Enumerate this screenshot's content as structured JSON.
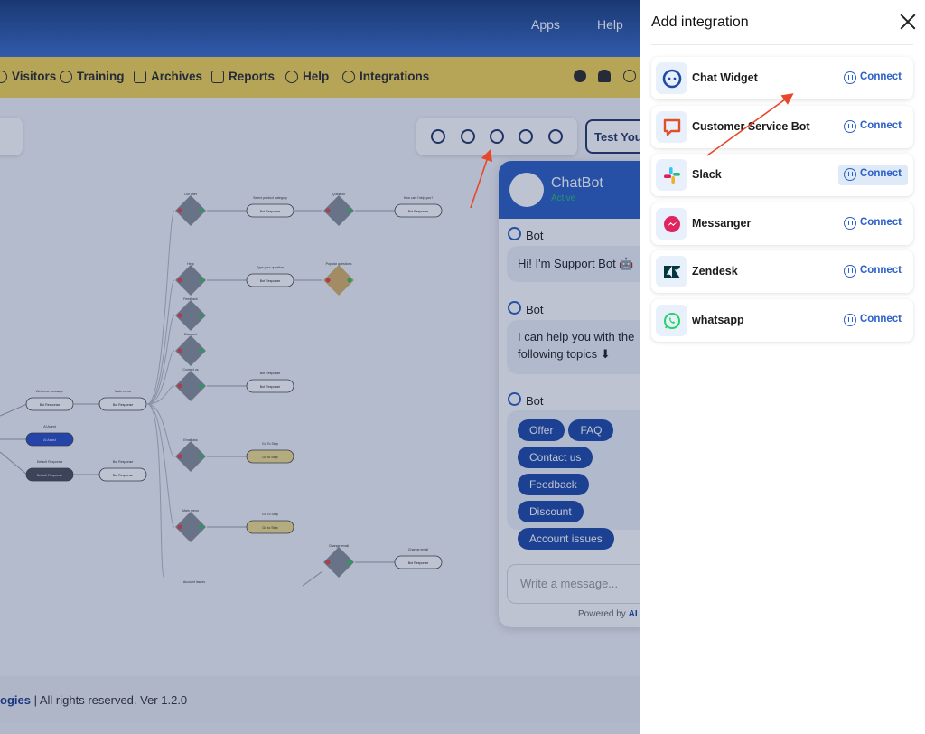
{
  "topbar": {
    "apps_label": "Apps",
    "help_label": "Help"
  },
  "nav": {
    "items": [
      {
        "label": "Visitors"
      },
      {
        "label": "Training"
      },
      {
        "label": "Archives"
      },
      {
        "label": "Reports"
      },
      {
        "label": "Help"
      },
      {
        "label": "Integrations"
      }
    ]
  },
  "toolbar": {
    "test_label": "Test Your"
  },
  "flow": {
    "node_labels": [
      "Our offer",
      "Select product category",
      "Question",
      "How can I help you?",
      "Help",
      "Type your question",
      "Popular questions",
      "Feedback",
      "Discount",
      "Contact us",
      "Bot Response",
      "Welcome message",
      "Main menu",
      "AI Agent",
      "Default Response",
      "Bot Response",
      "Email ask",
      "Go To Step",
      "Main menu",
      "Go To Step",
      "Change email",
      "Change email",
      "Account issues"
    ],
    "pill_labels": [
      "Bot Response",
      "Bot Response",
      "Bot Response",
      "Bot Response",
      "Bot Response",
      "Bot Response",
      "AI Assist",
      "Default Response",
      "Bot Response",
      "Go to Step",
      "Go to Step",
      "Bot Response"
    ]
  },
  "chat": {
    "title": "ChatBot",
    "status": "Active",
    "messages": [
      {
        "sender": "Bot",
        "text": "Hi! I'm Support Bot 🤖"
      },
      {
        "sender": "Bot",
        "text": "I can help you with the following topics ⬇"
      },
      {
        "sender": "Bot"
      }
    ],
    "chips": [
      "Offer",
      "FAQ",
      "Contact us",
      "Feedback",
      "Discount",
      "Account issues"
    ],
    "input_placeholder": "Write a message...",
    "powered_prefix": "Powered by",
    "powered_brand": "AI I"
  },
  "footer": {
    "brand_tail": "ogies",
    "text": "| All rights reserved.  Ver 1.2.0"
  },
  "panel": {
    "title": "Add integration",
    "integrations": [
      {
        "name": "Chat Widget",
        "icon": "chat-widget-icon",
        "color": "#1f4aa8",
        "connect": "Connect"
      },
      {
        "name": "Customer Service Bot",
        "icon": "customer-service-bot-icon",
        "color": "#e0502a",
        "connect": "Connect"
      },
      {
        "name": "Slack",
        "icon": "slack-icon",
        "color": "#4a154b",
        "connect": "Connect"
      },
      {
        "name": "Messanger",
        "icon": "messenger-icon",
        "color": "#e0245e",
        "connect": "Connect"
      },
      {
        "name": "Zendesk",
        "icon": "zendesk-icon",
        "color": "#03363d",
        "connect": "Connect"
      },
      {
        "name": "whatsapp",
        "icon": "whatsapp-icon",
        "color": "#25d366",
        "connect": "Connect"
      }
    ]
  },
  "colors": {
    "topbar": "#2a56a8",
    "navbar": "#f5d657",
    "accent": "#2b5fc9",
    "annotation_arrow": "#e8472b"
  }
}
